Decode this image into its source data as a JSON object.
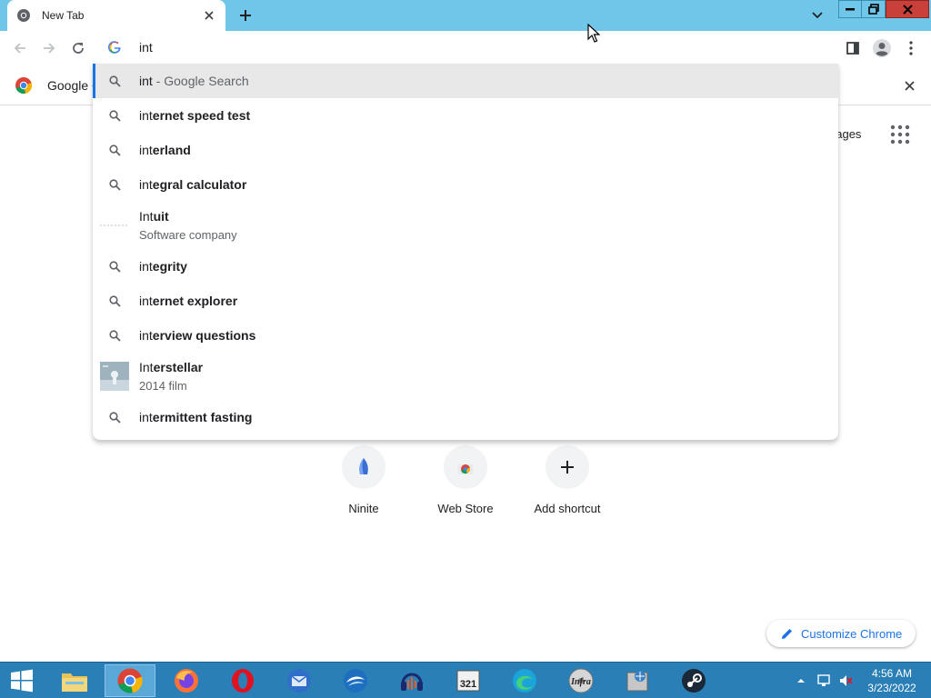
{
  "window": {
    "tab_title": "New Tab",
    "tab_favicon": "chrome-icon",
    "colors": {
      "titlebar": "#6fc6e8",
      "close_button": "#c9403a"
    }
  },
  "omnibox": {
    "value": "int"
  },
  "bookmarks": {
    "item_label": "Google C"
  },
  "suggestions": [
    {
      "prefix": "int",
      "rest": "",
      "suffix": " - Google Search",
      "icon": "search-icon",
      "selected": true
    },
    {
      "prefix": "int",
      "rest": "ernet speed test",
      "icon": "search-icon"
    },
    {
      "prefix": "int",
      "rest": "erland",
      "icon": "search-icon"
    },
    {
      "prefix": "int",
      "rest": "egral calculator",
      "icon": "search-icon"
    },
    {
      "prefix": "Int",
      "rest": "uit",
      "subtitle": "Software company",
      "icon": "intuit-logo"
    },
    {
      "prefix": "int",
      "rest": "egrity",
      "icon": "search-icon"
    },
    {
      "prefix": "int",
      "rest": "ernet explorer",
      "icon": "search-icon"
    },
    {
      "prefix": "int",
      "rest": "erview questions",
      "icon": "search-icon"
    },
    {
      "prefix": "Int",
      "rest": "erstellar",
      "subtitle": "2014 film",
      "icon": "interstellar-thumbnail"
    },
    {
      "prefix": "int",
      "rest": "ermittent fasting",
      "icon": "search-icon"
    }
  ],
  "ntp": {
    "images_link": "nages",
    "shortcuts": [
      {
        "label": "Ninite",
        "icon": "ninite-icon"
      },
      {
        "label": "Web Store",
        "icon": "webstore-icon"
      },
      {
        "label": "Add shortcut",
        "icon": "plus-icon"
      }
    ],
    "customize_label": "Customize Chrome"
  },
  "taskbar": {
    "apps": [
      "file-explorer",
      "chrome",
      "firefox",
      "opera",
      "thunderbird",
      "openoffice",
      "audacity",
      "media-player-classic",
      "infra-recorder",
      "filezilla",
      "steam"
    ],
    "active_app": "chrome",
    "clock_time": "4:56 AM",
    "clock_date": "3/23/2022"
  }
}
